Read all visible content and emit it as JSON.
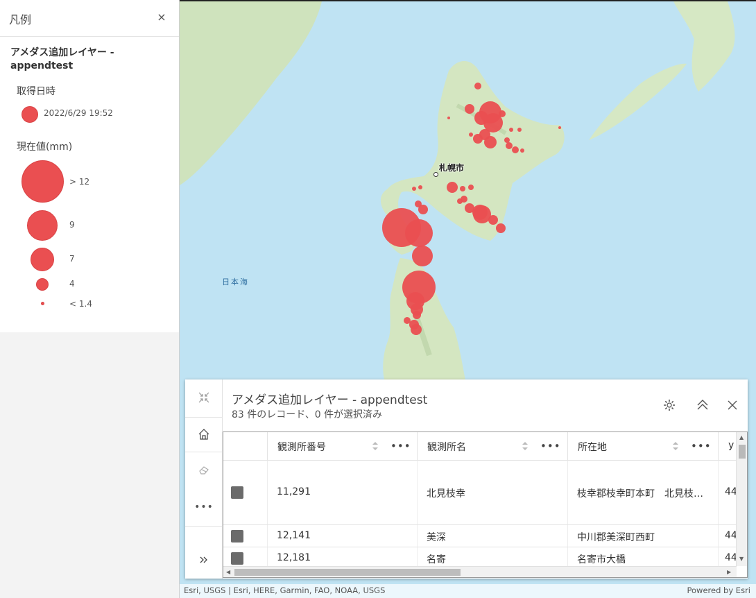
{
  "legend": {
    "title": "凡例",
    "close_glyph": "×",
    "layer_title": "アメダス追加レイヤー - appendtest",
    "section_date": {
      "heading": "取得日時",
      "label": "2022/6/29 19:52"
    },
    "section_value": {
      "heading": "現在値(mm)",
      "items": [
        {
          "label": "> 12",
          "value": "12"
        },
        {
          "label": "9",
          "value": "9"
        },
        {
          "label": "7",
          "value": "7"
        },
        {
          "label": "4",
          "value": "4"
        },
        {
          "label": "< 1.4",
          "value": "1.4"
        }
      ]
    },
    "symbol_color": "#ea4f51"
  },
  "map": {
    "city_label": "札幌市",
    "sea_label": "日本海",
    "attribution": "Esri, USGS | Esri, HERE, Garmin, FAO, NOAA, USGS",
    "powered_by": "Powered by Esri",
    "colors": {
      "water": "#bfe3f3",
      "land": "#eef1e6",
      "forest": "#cfe3bd",
      "point": "#ea4f51"
    }
  },
  "table": {
    "title": "アメダス追加レイヤー - appendtest",
    "subtitle": "83 件のレコード、0 件が選択済み",
    "side_buttons": [
      "collapse-icon",
      "home-icon",
      "eraser-icon",
      "more-icon",
      "expand-icon"
    ],
    "header_buttons": [
      "gear-icon",
      "chevron-up-double-icon",
      "close-icon"
    ],
    "more_glyph": "•••",
    "columns": [
      "観測所番号",
      "観測所名",
      "所在地",
      "y"
    ],
    "rows": [
      {
        "id": "11,291",
        "name": "北見枝幸",
        "address": "枝幸郡枝幸町本町　北見枝…",
        "y": "44"
      },
      {
        "id": "12,141",
        "name": "美深",
        "address": "中川郡美深町西町",
        "y": "44"
      },
      {
        "id": "12,181",
        "name": "名寄",
        "address": "名寄市大橋",
        "y": "44"
      }
    ]
  }
}
